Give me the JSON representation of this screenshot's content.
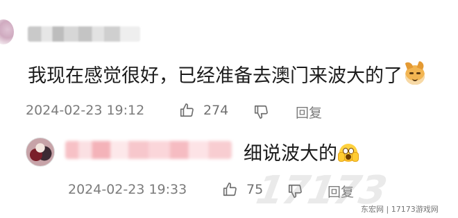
{
  "comment": {
    "text": "我现在感觉很好，已经准备去澳门来波大的了",
    "emoji": "dog-face-emoji",
    "timestamp": "2024-02-23 19:12",
    "likes": "274",
    "reply_label": "回复"
  },
  "reply": {
    "text": "细说波大的",
    "emoji": "screaming-face-emoji",
    "timestamp": "2024-02-23 19:33",
    "likes": "75",
    "reply_label": "回复"
  },
  "watermark": {
    "logo": "17173",
    "text": "东宏网 | 17173游戏网"
  },
  "colors": {
    "meta_text": "#7b7b7b",
    "body_text": "#1b1b1b"
  }
}
